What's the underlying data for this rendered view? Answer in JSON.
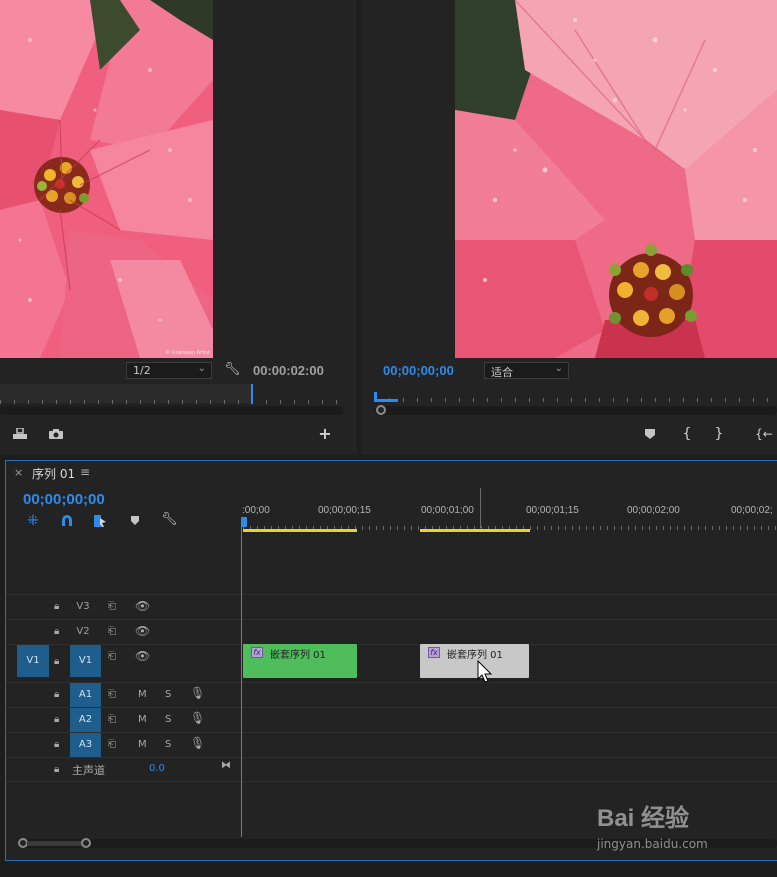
{
  "source_monitor": {
    "zoom_select": "1/2",
    "timecode": "00:00:02:00",
    "watermark": "© Unknown Artist"
  },
  "program_monitor": {
    "timecode": "00;00;00;00",
    "fit_select": "适合"
  },
  "timeline": {
    "close": "×",
    "tab_title": "序列 01",
    "menu": "≡",
    "timecode": "00;00;00;00",
    "ruler_labels": [
      ":00;00",
      "00;00;00;15",
      "00;00;01;00",
      "00;00;01;15",
      "00;00;02;00",
      "00;00;02;"
    ],
    "tracks": {
      "v3": "V3",
      "v2": "V2",
      "v1_source": "V1",
      "v1": "V1",
      "a1": "A1",
      "a2": "A2",
      "a3": "A3",
      "master": "主声道",
      "master_value": "0.0"
    },
    "track_buttons": {
      "mute": "M",
      "solo": "S"
    },
    "clips": [
      {
        "label": "嵌套序列 01",
        "fx": "fx",
        "color": "#4fbd5c"
      },
      {
        "label": "嵌套序列 01",
        "fx": "fx",
        "color": "#c8c8c8"
      }
    ]
  },
  "watermark": {
    "brand": "Bai 经验",
    "url": "jingyan.baidu.com"
  },
  "colors": {
    "accent": "#2d8ceb",
    "target_track": "#1e5d8c",
    "work_area": "#e8d533",
    "clip_green": "#4fbd5c",
    "clip_gray": "#c8c8c8"
  }
}
